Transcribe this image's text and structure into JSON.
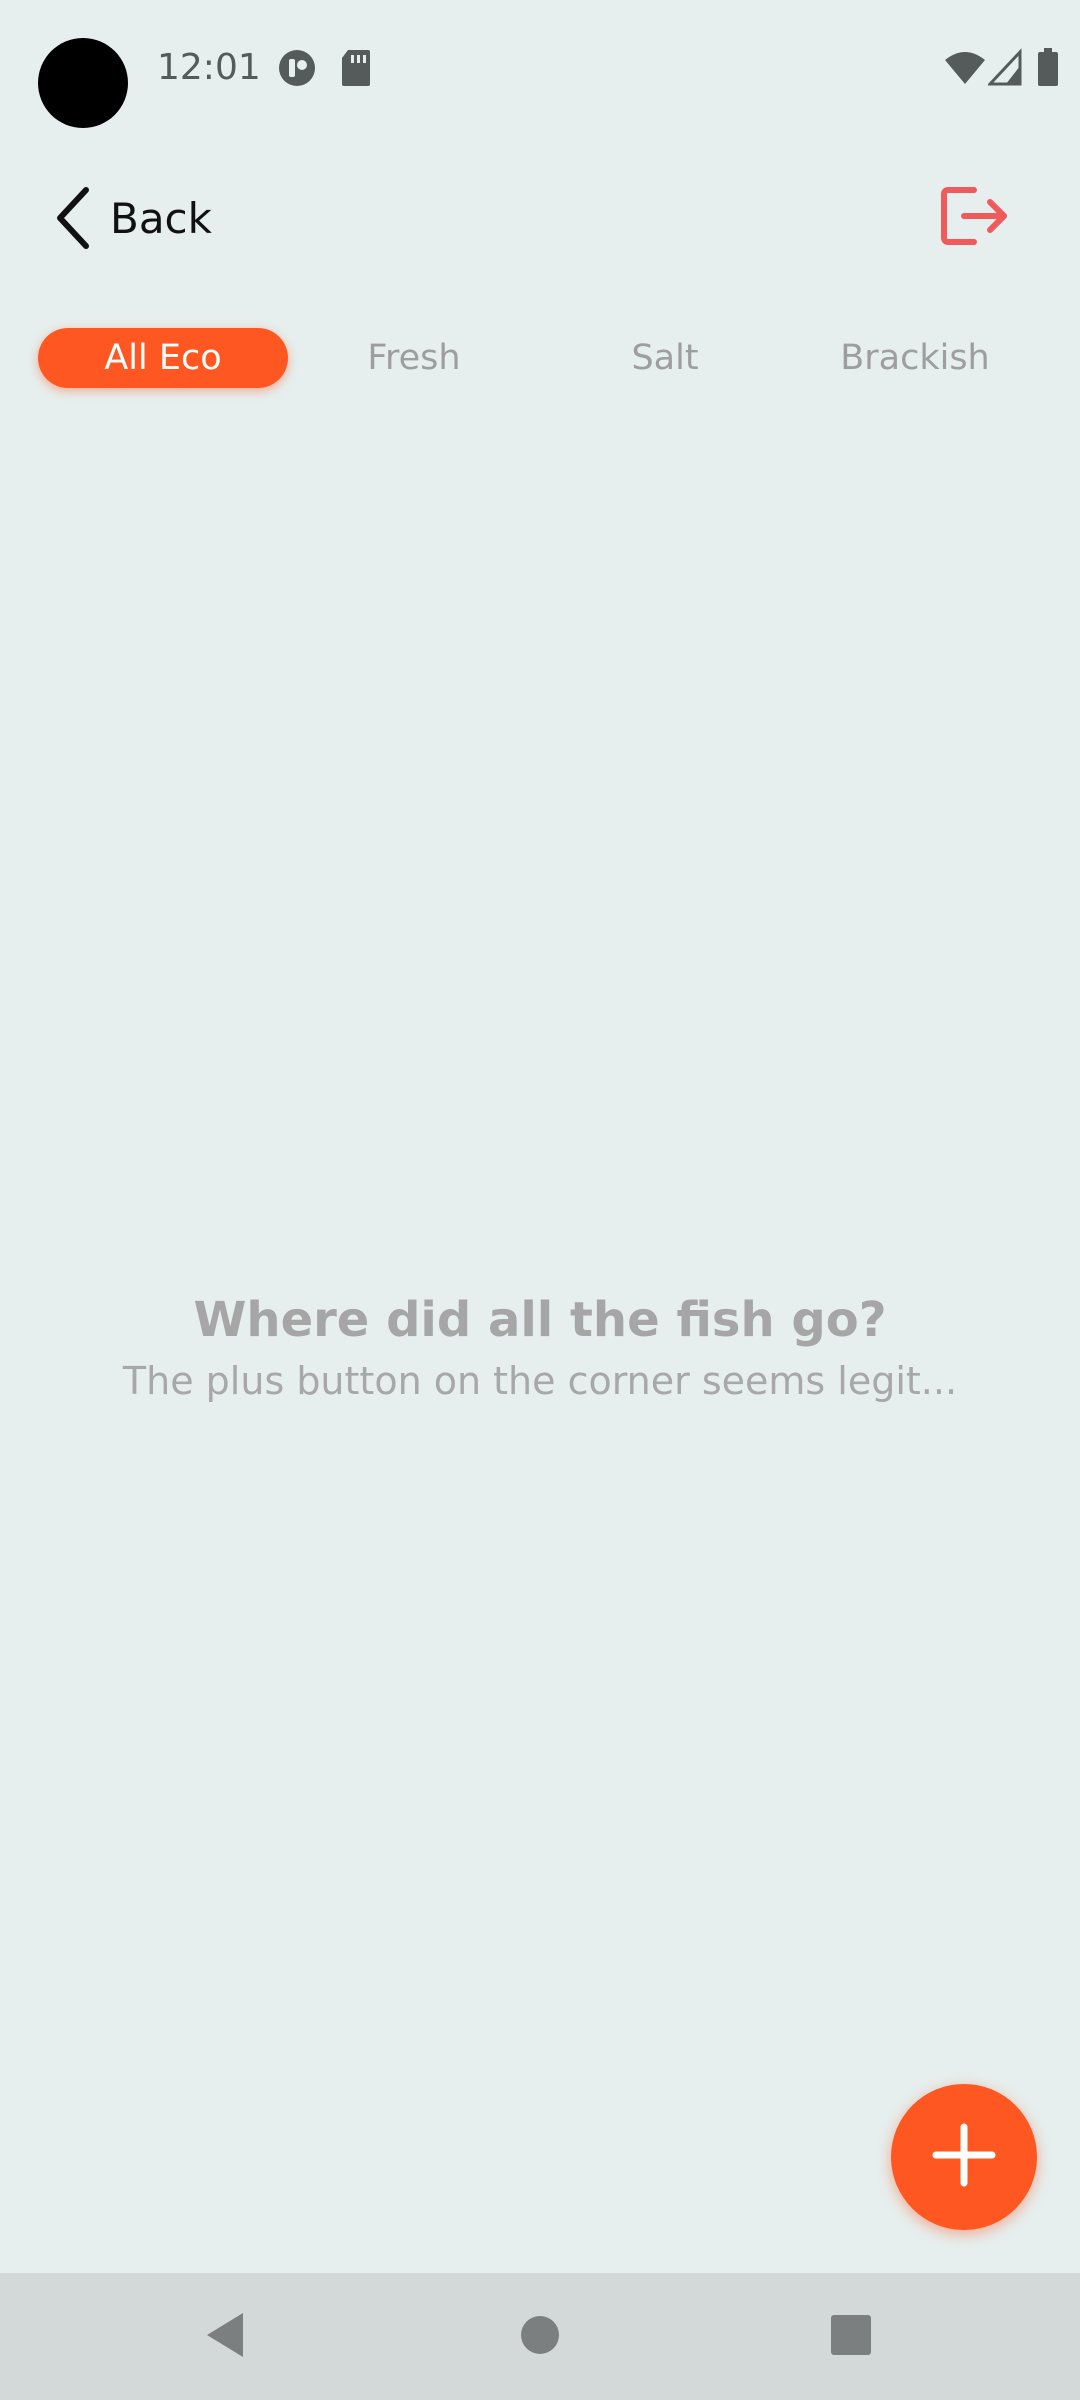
{
  "status_bar": {
    "time": "12:01",
    "icons": [
      "camera-cutout",
      "app-notification-icon",
      "sd-card-icon",
      "wifi-icon",
      "cell-signal-icon",
      "battery-icon"
    ]
  },
  "header": {
    "back_label": "Back",
    "back_icon": "chevron-left-icon",
    "logout_icon": "logout-icon"
  },
  "tabs": [
    {
      "label": "All Eco",
      "active": true
    },
    {
      "label": "Fresh",
      "active": false
    },
    {
      "label": "Salt",
      "active": false
    },
    {
      "label": "Brackish",
      "active": false
    }
  ],
  "empty_state": {
    "title": "Where did all the fish go?",
    "subtitle": "The plus button on the corner seems legit..."
  },
  "fab": {
    "icon": "plus-icon"
  },
  "nav_bar": {
    "icons": [
      "back-triangle-icon",
      "home-circle-icon",
      "recents-square-icon"
    ]
  },
  "colors": {
    "accent": "#ff5722",
    "logout": "#f05a5a",
    "background": "#e6efee",
    "nav_bar": "#d3d9d9"
  }
}
